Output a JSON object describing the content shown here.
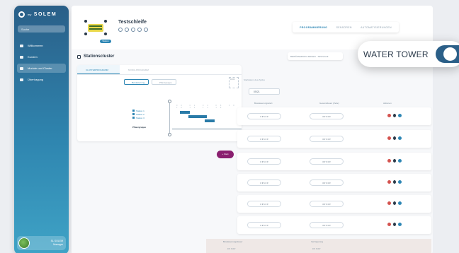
{
  "sidebar": {
    "logo_text": "SOLEM",
    "logo_prefix": "my",
    "search_placeholder": "Suche",
    "items": [
      {
        "label": "Willkommen",
        "icon": "home-icon"
      },
      {
        "label": "Kunden",
        "icon": "users-icon"
      },
      {
        "label": "Module und Cluster",
        "icon": "module-icon",
        "active": true
      },
      {
        "label": "Übertragung",
        "icon": "transfer-icon"
      }
    ],
    "user": {
      "name": "SL SOLEM",
      "role": "Manager"
    }
  },
  "header": {
    "title": "Testschleife",
    "station_badge": "Station",
    "tabs": [
      "PROGRAMMIERUNG",
      "SENSOREN",
      "AUTOMATISIERUNGEN"
    ],
    "active_tab": 0
  },
  "section": {
    "title": "Stationscluster",
    "right_text": "BEWÄSSERUNG ZEIGEN · TESTLAUF"
  },
  "cluster": {
    "tabs": [
      "CLUSTERPROGRAMM",
      "MODULPROGRAMM"
    ],
    "toggle": [
      "Bewässerung",
      "Pflanzgruppe"
    ],
    "legend": [
      "Station 1",
      "Station 2",
      "Station 3"
    ],
    "add_label": "Pflanzgruppe",
    "start_box": "01:00",
    "start_caption": "Startdatum des Zyklus",
    "start_value": "05/21",
    "purple_button": "+ Start"
  },
  "schedule": {
    "headers": [
      "Bewässerungsstart",
      "Gesamtdauer (Zeile)",
      "Aktionen"
    ],
    "rows": [
      {
        "start": "0 ▾  h  0 ▾",
        "duration": "0 ▾  h  0 ▾"
      },
      {
        "start": "0 ▾  h  0 ▾",
        "duration": "0 ▾  h  0 ▾"
      },
      {
        "start": "0 ▾  h  0 ▾",
        "duration": "0 ▾  h  0 ▾"
      },
      {
        "start": "0 ▾  h  0 ▾",
        "duration": "0 ▾  h  0 ▾"
      },
      {
        "start": "0 ▾  h  0 ▾",
        "duration": "0 ▾  h  0 ▾"
      },
      {
        "start": "0 ▾  h  0 ▾",
        "duration": "0 ▾  h  0 ▾"
      }
    ],
    "bottom": {
      "left_label": "Bewässerungsdauer",
      "right_label": "Verzögerung",
      "value": "0 ▾  h  0 ▾"
    }
  },
  "widget": {
    "label": "WATER TOWER",
    "enabled": true
  },
  "colors": {
    "accent": "#2d86b4",
    "sidebar": "#2a5f88",
    "danger": "#d4524e",
    "purple": "#8a1f6f"
  }
}
